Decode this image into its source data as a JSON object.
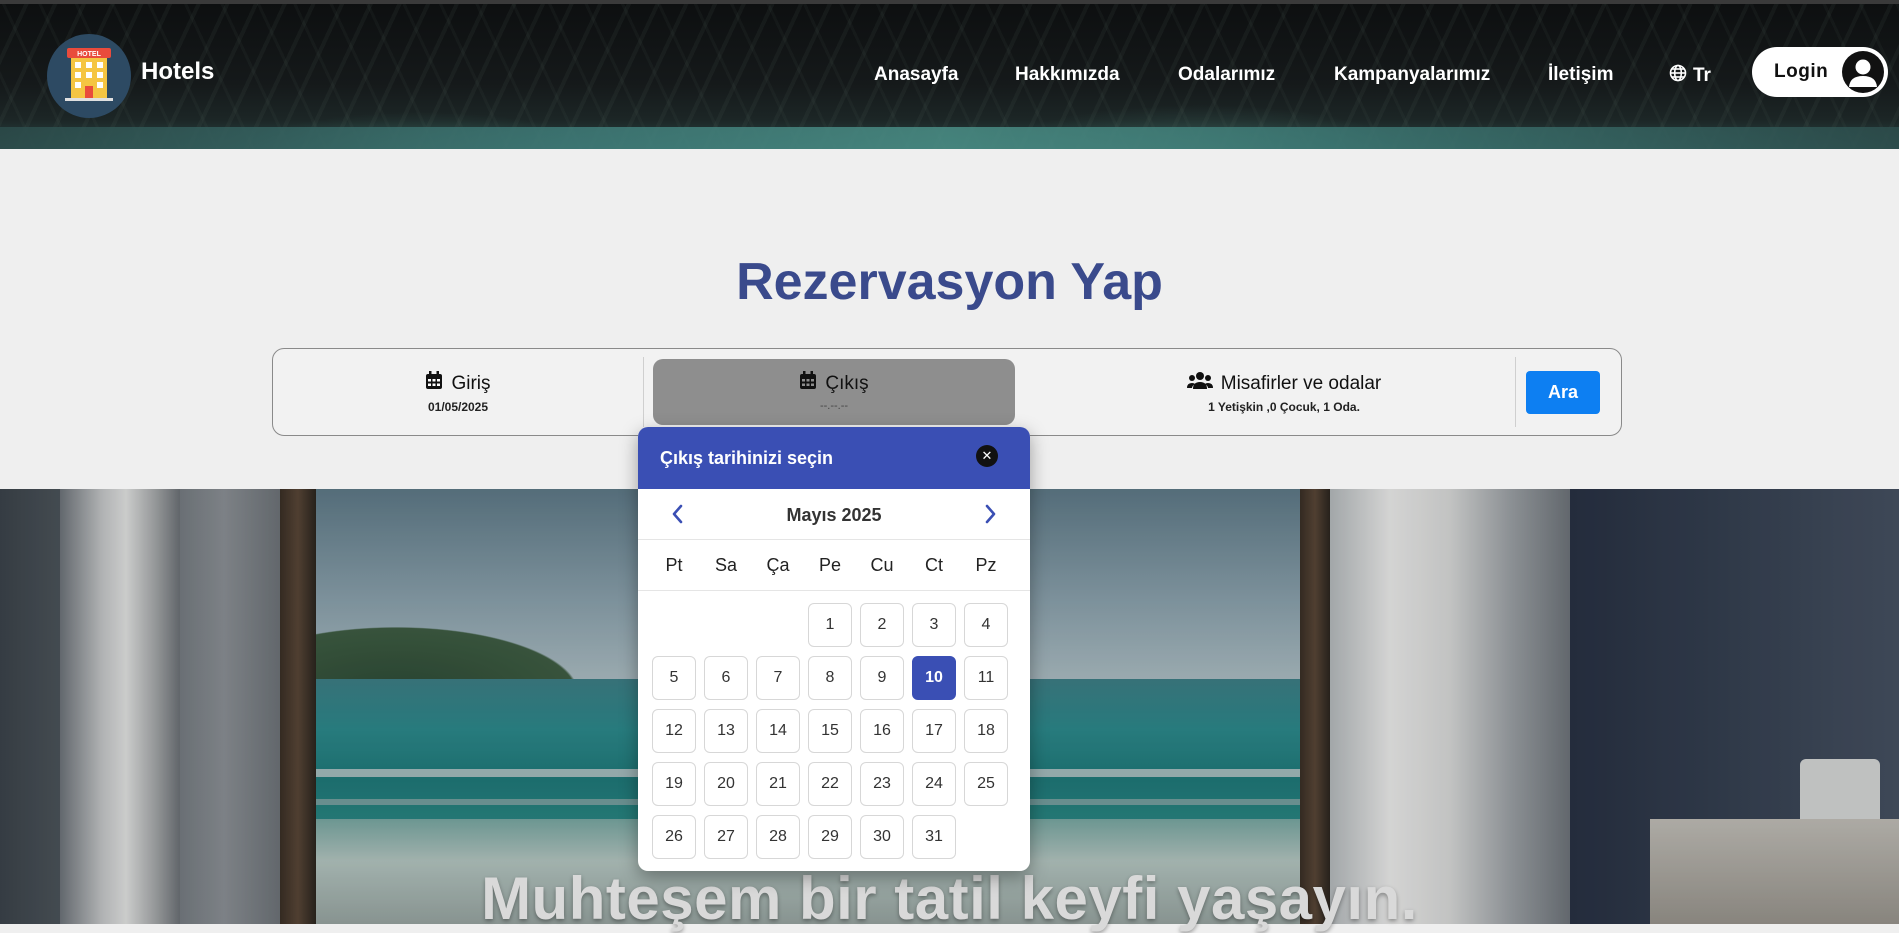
{
  "header": {
    "brand": "Hotels",
    "logo_icon": "hotel-building-icon",
    "nav": [
      {
        "label": "Anasayfa"
      },
      {
        "label": "Hakkımızda"
      },
      {
        "label": "Odalarımız"
      },
      {
        "label": "Kampanyalarımız"
      },
      {
        "label": "İletişim"
      }
    ],
    "language": {
      "icon": "globe-icon",
      "label": "Tr"
    },
    "login": {
      "label": "Login",
      "icon": "user-avatar-icon"
    }
  },
  "reservation": {
    "title": "Rezervasyon Yap",
    "checkin": {
      "label": "Giriş",
      "value": "01/05/2025",
      "icon": "calendar-icon"
    },
    "checkout": {
      "label": "Çıkış",
      "value": "--.--.--",
      "icon": "calendar-icon"
    },
    "guests": {
      "label": "Misafirler ve odalar",
      "value": "1 Yetişkin ,0 Çocuk, 1 Oda.",
      "icon": "users-icon"
    },
    "search_button": "Ara"
  },
  "datepicker": {
    "title": "Çıkış tarihinizi seçin",
    "close_icon": "close-icon",
    "month": "Mayıs 2025",
    "weekdays": [
      "Pt",
      "Sa",
      "Ça",
      "Pe",
      "Cu",
      "Ct",
      "Pz"
    ],
    "first_weekday_index": 3,
    "days": [
      "1",
      "2",
      "3",
      "4",
      "5",
      "6",
      "7",
      "8",
      "9",
      "10",
      "11",
      "12",
      "13",
      "14",
      "15",
      "16",
      "17",
      "18",
      "19",
      "20",
      "21",
      "22",
      "23",
      "24",
      "25",
      "26",
      "27",
      "28",
      "29",
      "30",
      "31"
    ],
    "selected_day": "10",
    "accent": "#3a4fb4"
  },
  "hero": {
    "headline": "Muhteşem bir tatil keyfi yaşayın."
  },
  "colors": {
    "title": "#3a4a8c",
    "primary_button": "#0d7ff2",
    "picker_header": "#3a4fb4"
  }
}
